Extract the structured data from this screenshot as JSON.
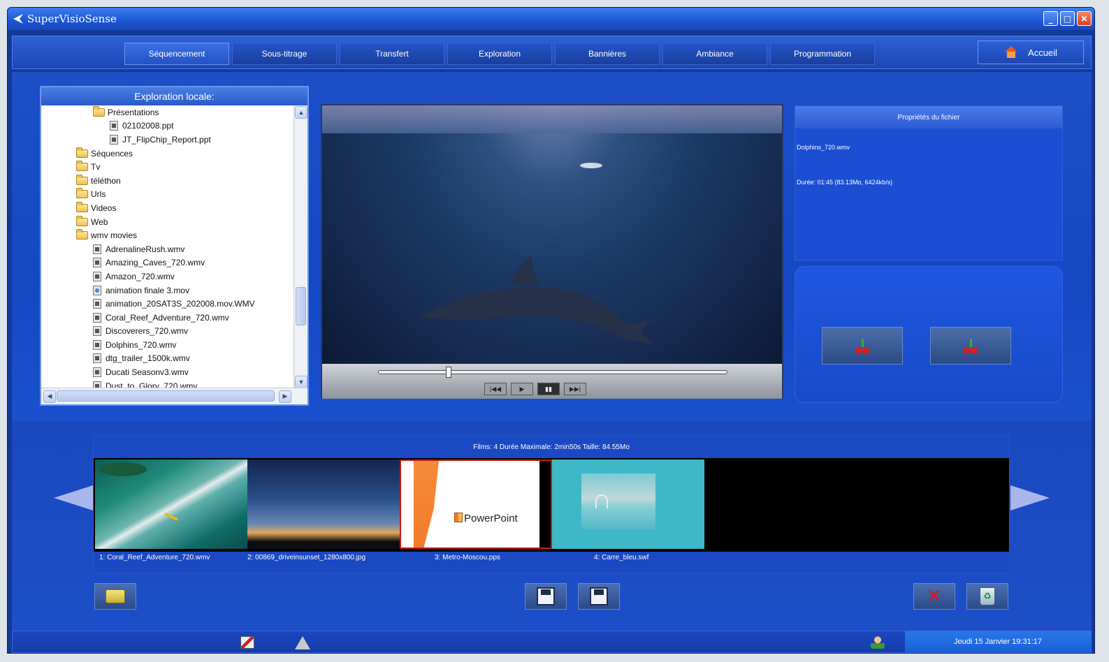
{
  "window": {
    "title": "SuperVisioSense",
    "controls": {
      "minimize": "_",
      "maximize": "□",
      "close": "✕"
    }
  },
  "tabs": [
    {
      "label": "Séquencement",
      "active": true
    },
    {
      "label": "Sous-titrage",
      "active": false
    },
    {
      "label": "Transfert",
      "active": false
    },
    {
      "label": "Exploration",
      "active": false
    },
    {
      "label": "Bannières",
      "active": false
    },
    {
      "label": "Ambiance",
      "active": false
    },
    {
      "label": "Programmation",
      "active": false
    }
  ],
  "home_button": {
    "label": "Accueil",
    "icon": "home-icon"
  },
  "explorer": {
    "title": "Exploration locale:",
    "items": [
      {
        "label": "Présentations",
        "type": "folder",
        "indent": 2
      },
      {
        "label": "02102008.ppt",
        "type": "file",
        "indent": 3
      },
      {
        "label": "JT_FlipChip_Report.ppt",
        "type": "file",
        "indent": 3
      },
      {
        "label": "Séquences",
        "type": "folder",
        "indent": 1
      },
      {
        "label": "Tv",
        "type": "folder",
        "indent": 1
      },
      {
        "label": "téléthon",
        "type": "folder",
        "indent": 1
      },
      {
        "label": "Urls",
        "type": "folder",
        "indent": 1
      },
      {
        "label": "Videos",
        "type": "folder",
        "indent": 1
      },
      {
        "label": "Web",
        "type": "folder",
        "indent": 1
      },
      {
        "label": "wmv movies",
        "type": "folder",
        "indent": 1
      },
      {
        "label": "AdrenalineRush.wmv",
        "type": "file",
        "indent": 2
      },
      {
        "label": "Amazing_Caves_720.wmv",
        "type": "file",
        "indent": 2
      },
      {
        "label": "Amazon_720.wmv",
        "type": "file",
        "indent": 2
      },
      {
        "label": "animation finale 3.mov",
        "type": "mov",
        "indent": 2
      },
      {
        "label": "animation_20SAT3S_202008.mov.WMV",
        "type": "file",
        "indent": 2
      },
      {
        "label": "Coral_Reef_Adventure_720.wmv",
        "type": "file",
        "indent": 2
      },
      {
        "label": "Discoverers_720.wmv",
        "type": "file",
        "indent": 2
      },
      {
        "label": "Dolphins_720.wmv",
        "type": "file",
        "indent": 2
      },
      {
        "label": "dtg_trailer_1500k.wmv",
        "type": "file",
        "indent": 2
      },
      {
        "label": "Ducati Seasonv3.wmv",
        "type": "file",
        "indent": 2
      },
      {
        "label": "Dust_to_Glory_720.wmv",
        "type": "file",
        "indent": 2
      }
    ],
    "scroll_up": "▲",
    "scroll_down": "▼",
    "scroll_left": "◀",
    "scroll_right": "▶"
  },
  "player": {
    "seek_fraction": 0.2,
    "buttons": [
      "|◀◀",
      "▶",
      "▮▮",
      "▶▶|"
    ],
    "active_button": 2
  },
  "properties": {
    "title": "Propriétés du fichier",
    "filename": "Dolphins_720.wmv",
    "duration": "Durée: 01:45 (83.13Mo, 6424kb/s)"
  },
  "timeline": {
    "summary": "Films: 4    Durée Maximale: 2min50s    Taille: 84.55Mo",
    "clips": [
      {
        "label": "1: Coral_Reef_Adventure_720.wmv"
      },
      {
        "label": "2: 00869_driveinsunset_1280x800.jpg"
      },
      {
        "label": "3: Metro-Moscou.pps",
        "selected": true,
        "overlay_text": "PowerPoint"
      },
      {
        "label": "4: Carre_bleu.swf"
      }
    ]
  },
  "toolbar": {
    "open": "folder-icon",
    "save": "save-icon",
    "save_as": "save-as-icon",
    "delete": "✕",
    "clear": "♻"
  },
  "statusbar": {
    "datetime": "Jeudi 15 Janvier  19:31:17"
  }
}
